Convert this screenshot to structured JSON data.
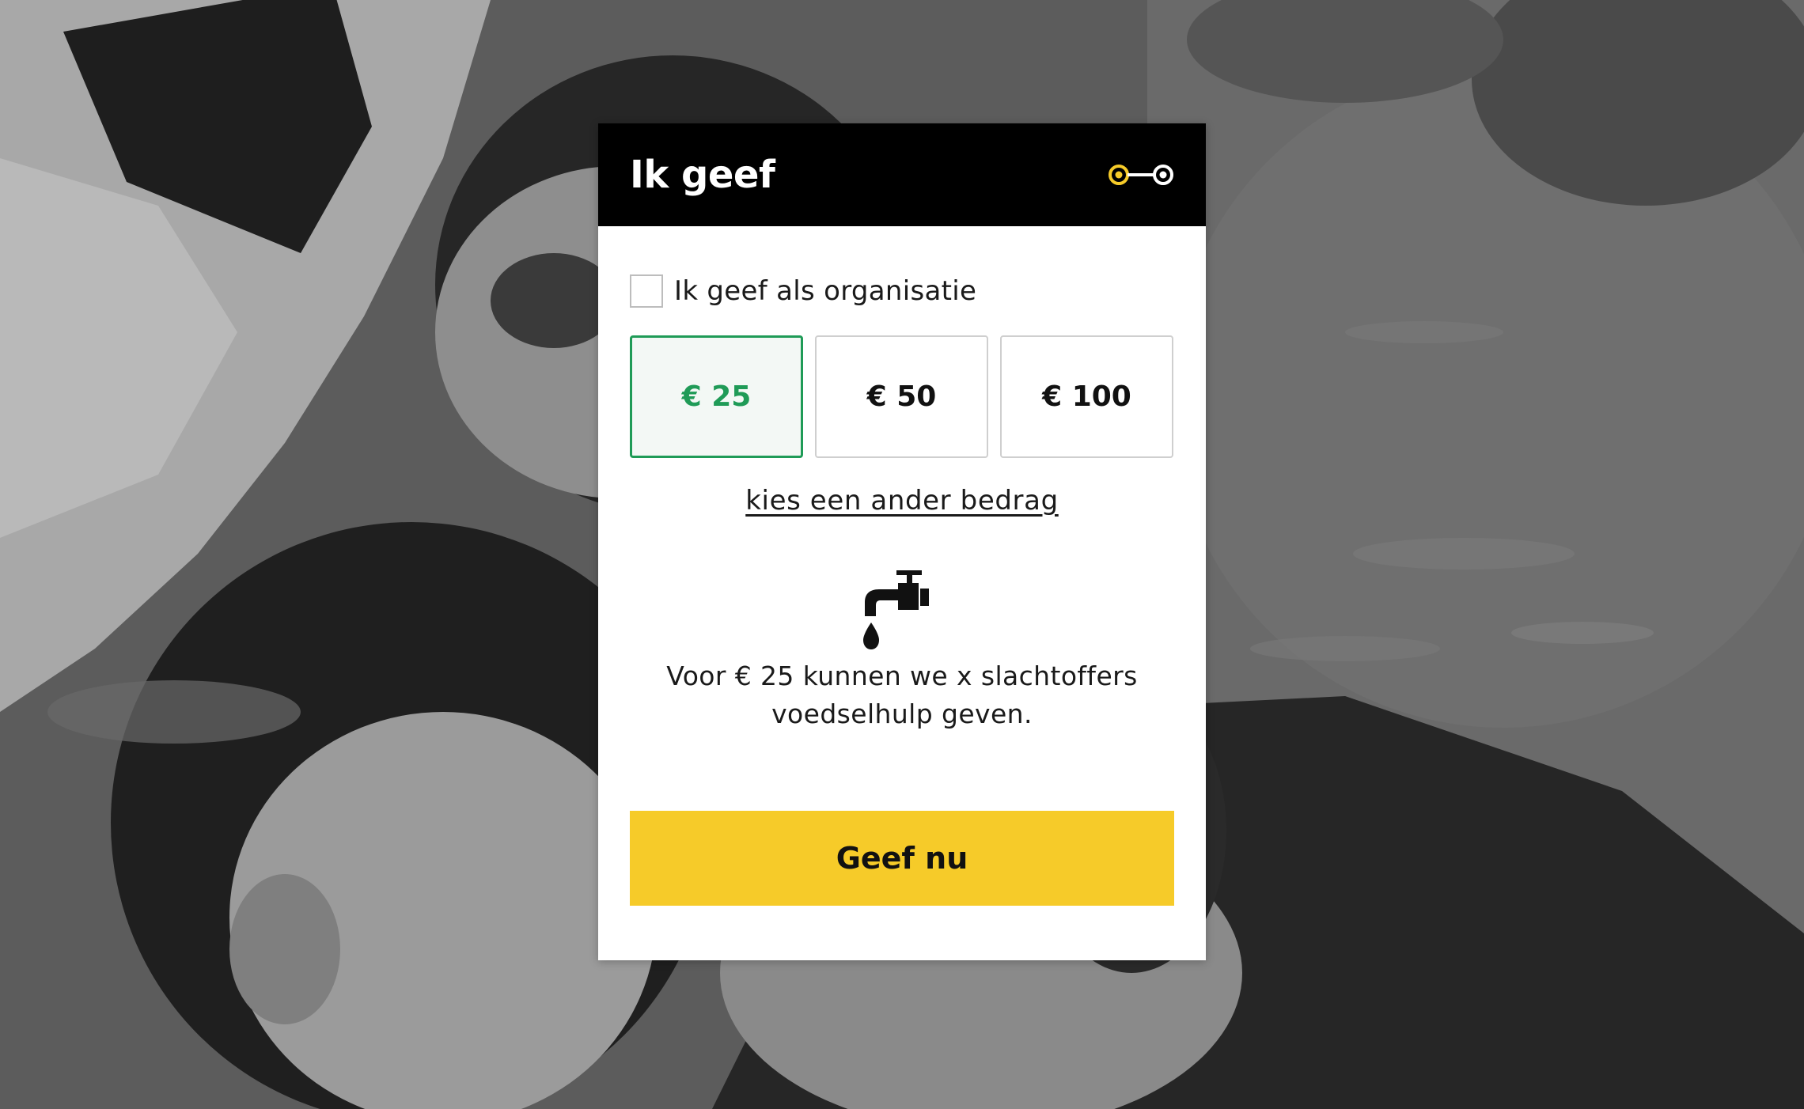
{
  "background": {
    "description_icon": "photo-background"
  },
  "widget": {
    "title": "Ik geef",
    "steps_icon": "step-indicator-icon",
    "organisation_label": "Ik geef als organisatie",
    "organisation_checked": false,
    "amounts": [
      {
        "label": "€ 25",
        "selected": true
      },
      {
        "label": "€ 50",
        "selected": false
      },
      {
        "label": "€ 100",
        "selected": false
      }
    ],
    "other_amount_link": "kies een ander bedrag",
    "impact_icon": "water-tap-icon",
    "impact_line1": "Voor € 25 kunnen we x slachtoffers",
    "impact_line2": "voedselhulp geven.",
    "donate_button": "Geef nu"
  },
  "colors": {
    "accent_green": "#1f9b57",
    "button_yellow": "#f6cb29",
    "header_black": "#000000",
    "step_yellow": "#f6cb29"
  }
}
